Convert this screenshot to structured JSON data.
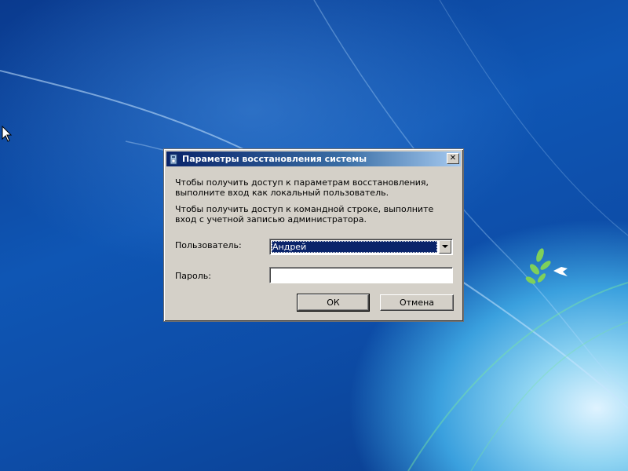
{
  "dialog": {
    "title": "Параметры восстановления системы",
    "text_local": "Чтобы получить доступ к параметрам восстановления, выполните вход как локальный пользователь.",
    "text_admin": "Чтобы получить доступ к командной строке, выполните вход с учетной записью администратора.",
    "user_label": "Пользователь:",
    "user_selected": "Андрей",
    "password_label": "Пароль:",
    "password_value": "",
    "ok_label": "ОК",
    "cancel_label": "Отмена",
    "close_glyph": "✕"
  },
  "icons": {
    "title": "recovery-icon",
    "close": "close-icon",
    "dropdown": "chevron-down-icon",
    "cursor": "mouse-pointer-icon"
  },
  "colors": {
    "dialog_bg": "#d4d0c8",
    "titlebar_start": "#0a246a",
    "titlebar_end": "#a6caf0",
    "selection": "#0a246a"
  }
}
